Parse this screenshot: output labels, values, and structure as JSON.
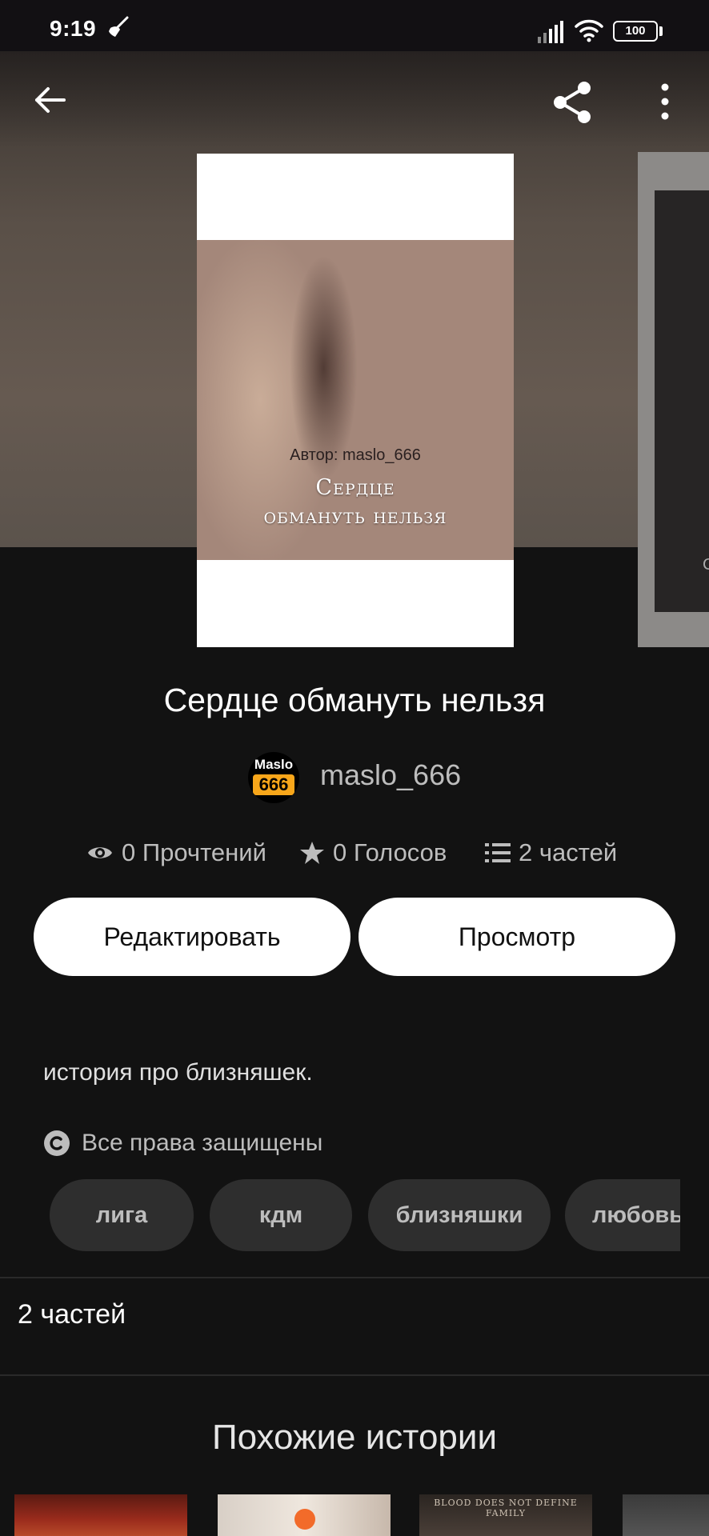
{
  "status_bar": {
    "time": "9:19",
    "battery": "100"
  },
  "cover": {
    "author_caption": "Автор: maslo_666",
    "title_line1": "Сердце",
    "title_line2": "обмануть нельзя"
  },
  "next_cover_char": "С",
  "book": {
    "title": "Сердце обмануть нельзя",
    "author": "maslo_666",
    "avatar_top": "Maslo",
    "avatar_num": "666"
  },
  "stats": {
    "reads": "0 Прочтений",
    "votes": "0 Голосов",
    "parts": "2 частей"
  },
  "buttons": {
    "edit": "Редактировать",
    "preview": "Просмотр"
  },
  "description": "история про близняшек.",
  "copyright": "Все права защищены",
  "tags": [
    "лига",
    "кдм",
    "близняшки",
    "любовь"
  ],
  "parts_section": "2 частей",
  "similar": {
    "title": "Похожие истории",
    "thumb3_text": "BLOOD DOES NOT DEFINE FAMILY"
  },
  "colors": {
    "background": "#121212",
    "button_bg": "#ffffff",
    "tag_bg": "#2e2e2e",
    "avatar_accent": "#f7a61a"
  }
}
